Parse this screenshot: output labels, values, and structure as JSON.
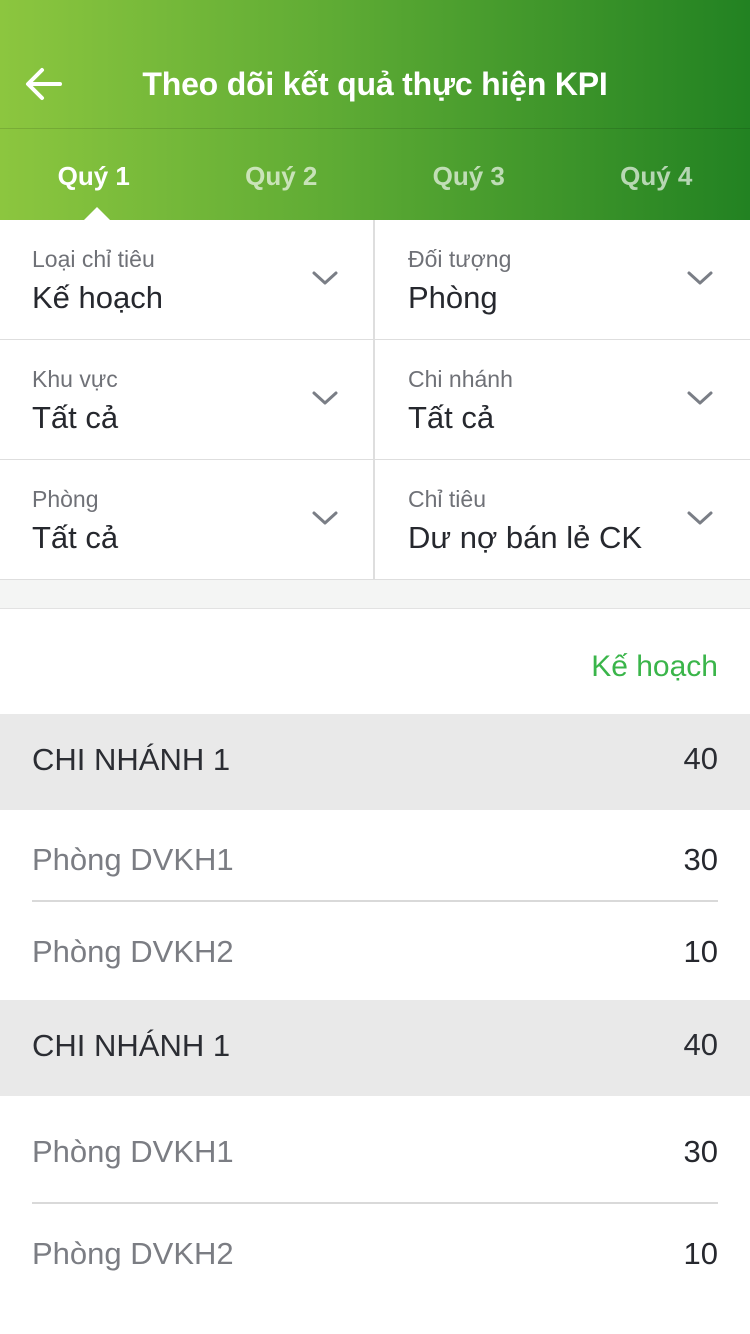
{
  "header": {
    "title": "Theo dõi kết quả thực hiện KPI",
    "back_icon": "arrow-left-icon"
  },
  "tabs": [
    {
      "label": "Quý 1",
      "active": true
    },
    {
      "label": "Quý 2",
      "active": false
    },
    {
      "label": "Quý 3",
      "active": false
    },
    {
      "label": "Quý 4",
      "active": false
    }
  ],
  "filters": [
    {
      "label": "Loại chỉ tiêu",
      "value": "Kế hoạch"
    },
    {
      "label": "Đối tượng",
      "value": "Phòng"
    },
    {
      "label": "Khu vực",
      "value": "Tất cả"
    },
    {
      "label": "Chi nhánh",
      "value": "Tất cả"
    },
    {
      "label": "Phòng",
      "value": "Tất cả"
    },
    {
      "label": "Chỉ tiêu",
      "value": "Dư nợ bán lẻ CK"
    }
  ],
  "table": {
    "column_header": "Kế hoạch",
    "groups": [
      {
        "name": "CHI NHÁNH 1",
        "value": "40",
        "items": [
          {
            "name": "Phòng DVKH1",
            "value": "30"
          },
          {
            "name": "Phòng DVKH2",
            "value": "10"
          }
        ]
      },
      {
        "name": "CHI NHÁNH 1",
        "value": "40",
        "items": [
          {
            "name": "Phòng DVKH1",
            "value": "30"
          },
          {
            "name": "Phòng DVKH2",
            "value": "10"
          }
        ]
      }
    ]
  },
  "colors": {
    "header_gradient_start": "#8cc63f",
    "header_gradient_end": "#228222",
    "accent_green": "#3ab54a",
    "group_row_bg": "#e9e9e9"
  }
}
